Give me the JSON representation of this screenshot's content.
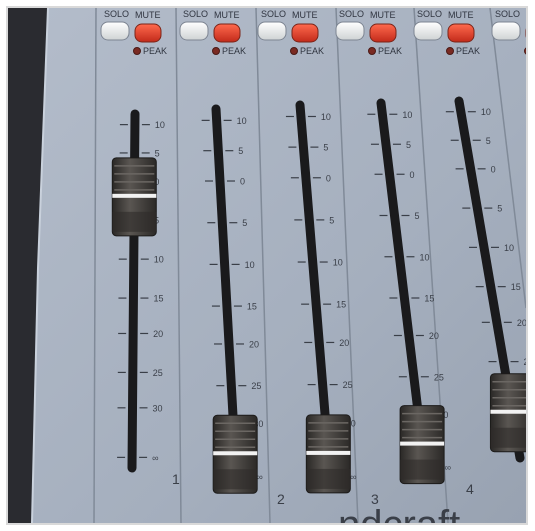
{
  "buttons": {
    "solo_label": "SOLO",
    "mute_label": "MUTE",
    "peak_label": "PEAK"
  },
  "scale_labels": [
    "10",
    "5",
    "0",
    "5",
    "10",
    "15",
    "20",
    "25",
    "30",
    "∞"
  ],
  "channels": [
    {
      "number": "1",
      "fader_level": 0.78
    },
    {
      "number": "2",
      "fader_level": 0.06
    },
    {
      "number": "3",
      "fader_level": 0.06
    },
    {
      "number": "4",
      "fader_level": 0.06
    },
    {
      "number": "",
      "fader_level": 0.1
    }
  ],
  "brand_text": "ndcraft",
  "colors": {
    "panel": "#a9b3c2",
    "mute_red": "#d83a28",
    "solo_white": "#eef0f0",
    "peak_led": "#7a2a22",
    "slot": "#1a1a1c",
    "knob": "#3d3a38"
  }
}
